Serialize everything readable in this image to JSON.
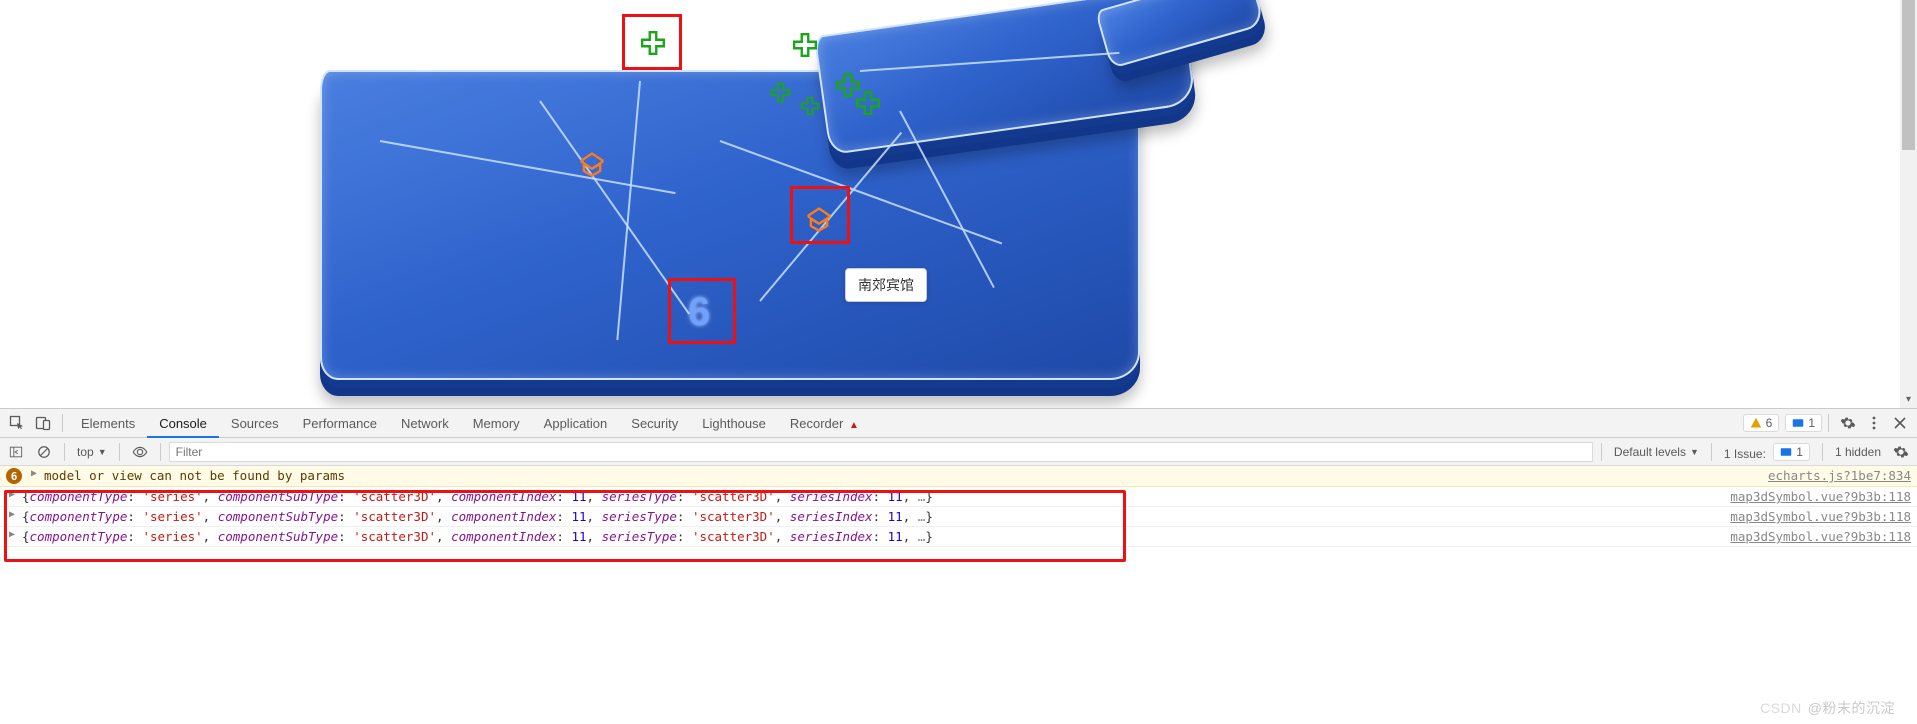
{
  "tooltip_text": "南郊宾馆",
  "map_number": "6",
  "tabs": {
    "items": [
      "Elements",
      "Console",
      "Sources",
      "Performance",
      "Network",
      "Memory",
      "Application",
      "Security",
      "Lighthouse",
      "Recorder"
    ],
    "active": 1,
    "recorder_beta_icon": "▲"
  },
  "right_badges": {
    "warn_count": "6",
    "info_count": "1"
  },
  "console_toolbar": {
    "context": "top",
    "filter_placeholder": "Filter",
    "levels_label": "Default levels",
    "issues_label": "1 Issue:",
    "issues_count": "1",
    "hidden_label": "1 hidden"
  },
  "warn_log": {
    "count": "6",
    "message": "model or view can not be found by params",
    "source": "echarts.js?1be7:834"
  },
  "obj_log": {
    "componentType": "series",
    "componentSubType": "scatter3D",
    "componentIndex": "11",
    "seriesType": "scatter3D",
    "seriesIndex": "11",
    "source": "map3dSymbol.vue?9b3b:118"
  },
  "watermark": {
    "prefix": "CSDN",
    "handle": "@粉末的沉淀"
  }
}
